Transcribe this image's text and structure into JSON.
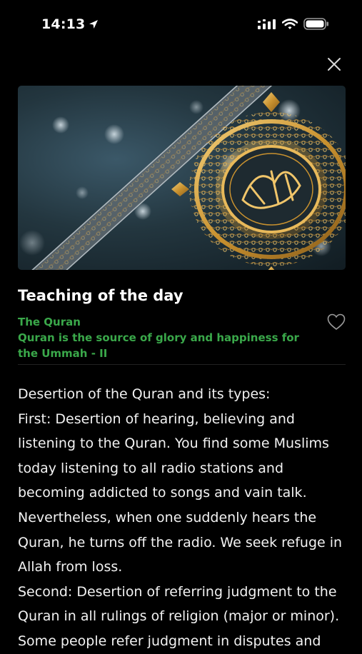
{
  "status_bar": {
    "time": "14:13",
    "icons": [
      "location-arrow-icon",
      "cellular-signal-icon",
      "wifi-icon",
      "battery-icon"
    ]
  },
  "close": {
    "icon": "close-icon"
  },
  "hero_image": {
    "description_icon": "quran-ornament-image"
  },
  "teaching": {
    "heading": "Teaching of the day",
    "source": "The Quran",
    "topic": "Quran is the source of glory and happiness for the Ummah - II",
    "favorite_icon": "heart-outline-icon",
    "paragraphs": [
      "Desertion of the Quran and its types:",
      "First: Desertion of hearing, believing and listening to the Quran. You find some Muslims today listening to all radio stations and becoming addicted to songs and vain talk. Nevertheless, when one suddenly hears the Quran, he turns off the radio. We seek refuge in Allah from loss.",
      "Second: Desertion of referring judgment to the Quran in all rulings of religion (major or minor). Some people refer judgment in disputes and"
    ]
  },
  "colors": {
    "background": "#000000",
    "accent_green": "#3aa84a",
    "text": "#f2f2f2"
  }
}
